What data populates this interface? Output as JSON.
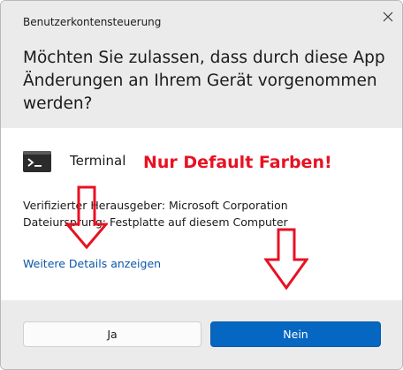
{
  "window": {
    "title": "Benutzerkontensteuerung",
    "close_icon": "close-icon"
  },
  "prompt": {
    "question": "Möchten Sie zulassen, dass durch diese App Änderungen an Ihrem Gerät vorgenommen werden?"
  },
  "app": {
    "name": "Terminal",
    "icon": "terminal-icon"
  },
  "annotation": {
    "text": "Nur Default Farben!",
    "color": "#e81123",
    "arrows": [
      "down-arrow",
      "down-arrow"
    ]
  },
  "info": {
    "publisher": "Verifizierter Herausgeber: Microsoft Corporation",
    "origin": "Dateiursprung: Festplatte auf diesem Computer"
  },
  "details_link": "Weitere Details anzeigen",
  "buttons": {
    "yes": "Ja",
    "no": "Nein"
  },
  "colors": {
    "accent": "#0567c2",
    "header_bg": "#ebebeb",
    "link": "#0b56a8"
  }
}
